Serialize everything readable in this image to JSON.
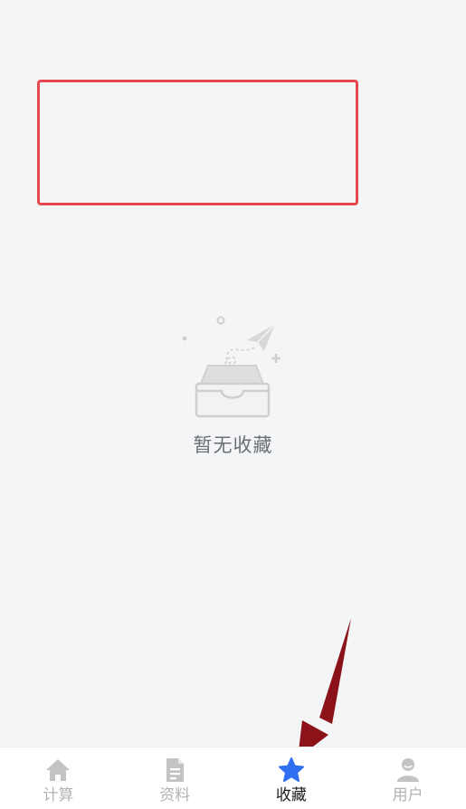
{
  "empty_state": {
    "message": "暂无收藏",
    "icon": "empty-inbox-icon"
  },
  "tab_bar": {
    "tabs": [
      {
        "label": "计算",
        "icon": "home-icon",
        "active": false
      },
      {
        "label": "资料",
        "icon": "document-icon",
        "active": false
      },
      {
        "label": "收藏",
        "icon": "star-icon",
        "active": true
      },
      {
        "label": "用户",
        "icon": "user-icon",
        "active": false
      }
    ]
  },
  "colors": {
    "background": "#f4f5f7",
    "highlight_border": "#e5484d",
    "active_icon": "#2f6ff2",
    "inactive_icon": "#c3c3c3",
    "arrow": "#8b1218"
  }
}
